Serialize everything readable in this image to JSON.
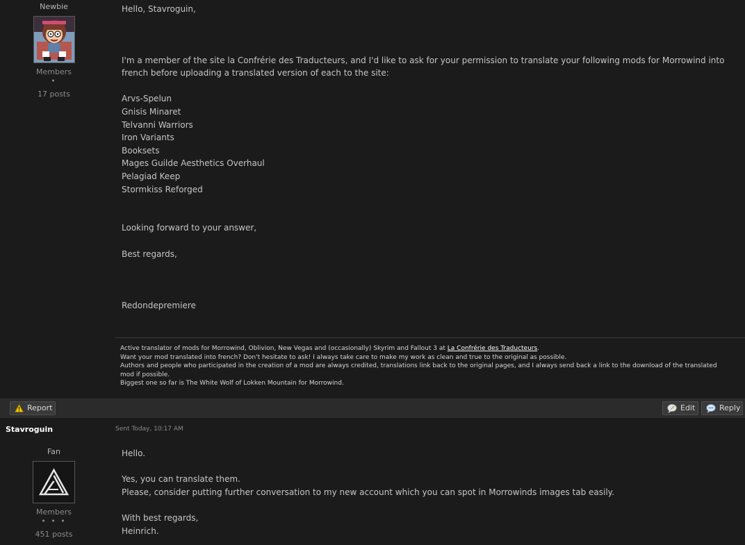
{
  "post1": {
    "author_rank": "Newbie",
    "author_group": "Members",
    "author_pips": "•",
    "author_posts": "17 posts",
    "greeting": "Hello, Stavroguin,",
    "intro": "I'm a member of the site la Confrérie des Traducteurs, and I'd like to ask for your permission to translate your following mods for Morrowind into french before uploading a translated version of each to the site:",
    "mods": [
      "Arvs-Spelun",
      "Gnisis Minaret",
      "Telvanni Warriors",
      "Iron Variants",
      "Booksets",
      "Mages Guilde Aesthetics Overhaul",
      "Pelagiad Keep",
      "Stormkiss Reforged"
    ],
    "closing1": "Looking forward to your answer,",
    "closing2": "Best regards,",
    "signature_name": "Redondepremiere",
    "sig": {
      "line1_text": "Active translator of mods for Morrowind, Oblivion, New Vegas and (occasionally) Skyrim and Fallout 3 at",
      "line1_link": "La Confrérie des Traducteurs",
      "line1_end": ".",
      "line2": "Want your mod translated into french? Don't hesitate to ask! I always take care to make my work as clean and true to the original as possible.",
      "line3": "Authors and people who participated in the creation of a mod are always credited, translations link back to the original pages, and I always send back a link to the download of the translated mod if possible.",
      "line4": "Biggest one so far is The White Wolf of Lokken Mountain for Morrowind."
    }
  },
  "actions": {
    "report": "Report",
    "edit": "Edit",
    "reply": "Reply"
  },
  "post2": {
    "author_name": "Stavroguin",
    "sent": "Sent Today, 10:17 AM",
    "author_rank": "Fan",
    "author_group": "Members",
    "author_pips": "• • •",
    "author_posts": "451 posts",
    "line1": "Hello.",
    "line2": "Yes, you can translate them.",
    "line3": "Please, consider putting further conversation to my new account which you can spot in Morrowinds images tab easily.",
    "line4": "With best regards,",
    "line5": "Heinrich."
  },
  "colors": {
    "background": "#1b1b1c",
    "bar": "#2b2b2c",
    "text": "#c6c6c6",
    "report_icon": "#f2c200"
  },
  "icons": {
    "report": "warning-icon",
    "edit": "edit-bubble-icon",
    "reply": "reply-bubble-icon"
  }
}
